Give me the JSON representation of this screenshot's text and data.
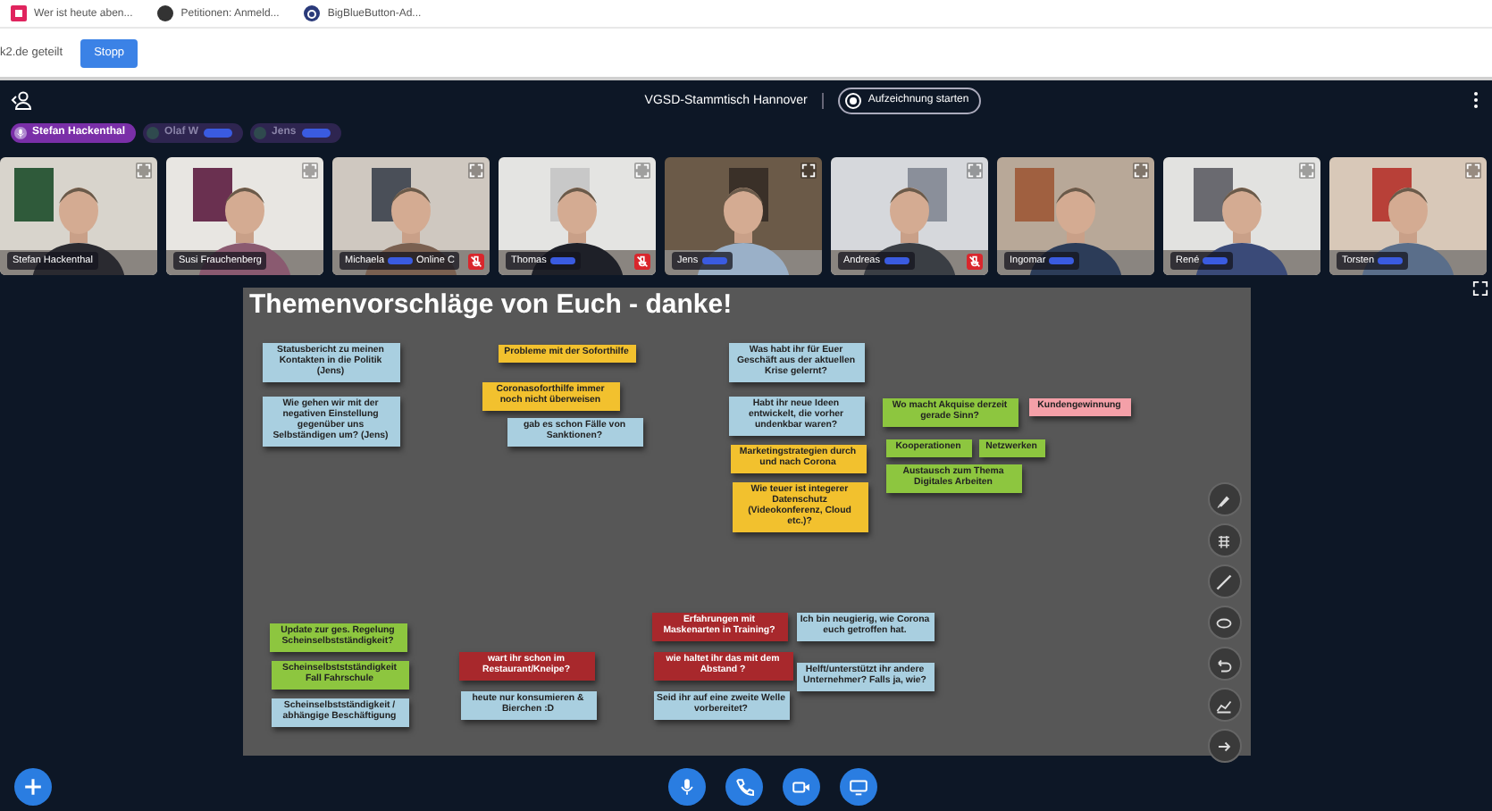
{
  "browser_tabs": [
    {
      "label": "Wer ist heute aben..."
    },
    {
      "label": "Petitionen: Anmeld..."
    },
    {
      "label": "BigBlueButton-Ad..."
    }
  ],
  "share_bar": {
    "message": "k2.de geteilt",
    "button": "Stopp"
  },
  "header": {
    "title": "VGSD-Stammtisch Hannover",
    "record_button": "Aufzeichnung starten"
  },
  "talking_indicators": [
    {
      "name": "Stefan Hackenthal",
      "talking": true,
      "redacted": false
    },
    {
      "name": "Olaf W",
      "talking": false,
      "redacted": true
    },
    {
      "name": "Jens",
      "talking": false,
      "redacted": true
    }
  ],
  "video_tiles": [
    {
      "name": "Stefan Hackenthal",
      "muted": false,
      "redacted": false
    },
    {
      "name": "Susi Frauchenberg",
      "muted": false,
      "redacted": false
    },
    {
      "name": "Michaela",
      "suffix": "Online C",
      "muted": true,
      "redacted": true
    },
    {
      "name": "Thomas",
      "muted": true,
      "redacted": true
    },
    {
      "name": "Jens",
      "muted": false,
      "redacted": true
    },
    {
      "name": "Andreas",
      "muted": true,
      "redacted": true
    },
    {
      "name": "Ingomar",
      "muted": false,
      "redacted": true
    },
    {
      "name": "René",
      "muted": false,
      "redacted": true
    },
    {
      "name": "Torsten",
      "muted": false,
      "redacted": true
    }
  ],
  "whiteboard": {
    "title": "Themenvorschläge von Euch - danke!",
    "notes": [
      {
        "text": "Statusbericht zu meinen Kontakten in die Politik (Jens)",
        "color": "#a9cfe0"
      },
      {
        "text": "Wie gehen wir mit der negativen Einstellung gegenüber uns Selbständigen um? (Jens)",
        "color": "#a9cfe0"
      },
      {
        "text": "Probleme mit der Soforthilfe",
        "color": "#f2c12e"
      },
      {
        "text": "Coronasoforthilfe immer noch nicht überweisen",
        "color": "#f2c12e"
      },
      {
        "text": "gab es schon Fälle von Sanktionen?",
        "color": "#a9cfe0"
      },
      {
        "text": "Was habt ihr für Euer Geschäft aus der aktuellen Krise gelernt?",
        "color": "#a9cfe0"
      },
      {
        "text": "Habt ihr neue Ideen entwickelt, die vorher undenkbar waren?",
        "color": "#a9cfe0"
      },
      {
        "text": "Marketingstrategien durch und nach Corona",
        "color": "#f2c12e"
      },
      {
        "text": "Wie teuer ist integerer Datenschutz (Videokonferenz, Cloud etc.)?",
        "color": "#f2c12e"
      },
      {
        "text": "Wo macht Akquise derzeit gerade Sinn?",
        "color": "#8dc63f"
      },
      {
        "text": "Kundengewinnung",
        "color": "#f4a0a8"
      },
      {
        "text": "Kooperationen",
        "color": "#8dc63f"
      },
      {
        "text": "Netzwerken",
        "color": "#8dc63f"
      },
      {
        "text": "Austausch zum Thema Digitales Arbeiten",
        "color": "#8dc63f"
      },
      {
        "text": "Update zur ges. Regelung Scheinselbstständigkeit?",
        "color": "#8dc63f"
      },
      {
        "text": "Scheinselbststständigkeit Fall Fahrschule",
        "color": "#8dc63f"
      },
      {
        "text": "Scheinselbstständigkeit / abhängige Beschäftigung",
        "color": "#a9cfe0"
      },
      {
        "text": "wart ihr schon im Restaurant/Kneipe?",
        "color": "#a8282c"
      },
      {
        "text": "heute nur konsumieren & Bierchen :D",
        "color": "#a9cfe0"
      },
      {
        "text": "Erfahrungen mit Maskenarten in Training?",
        "color": "#a8282c"
      },
      {
        "text": "wie haltet ihr das mit dem Abstand ?",
        "color": "#a8282c"
      },
      {
        "text": "Seid ihr auf eine zweite Welle vorbereitet?",
        "color": "#a9cfe0"
      },
      {
        "text": "Ich bin neugierig, wie Corona euch getroffen hat.",
        "color": "#a9cfe0"
      },
      {
        "text": "Helft/unterstützt ihr andere Unternehmer? Falls ja, wie?",
        "color": "#a9cfe0"
      }
    ]
  }
}
